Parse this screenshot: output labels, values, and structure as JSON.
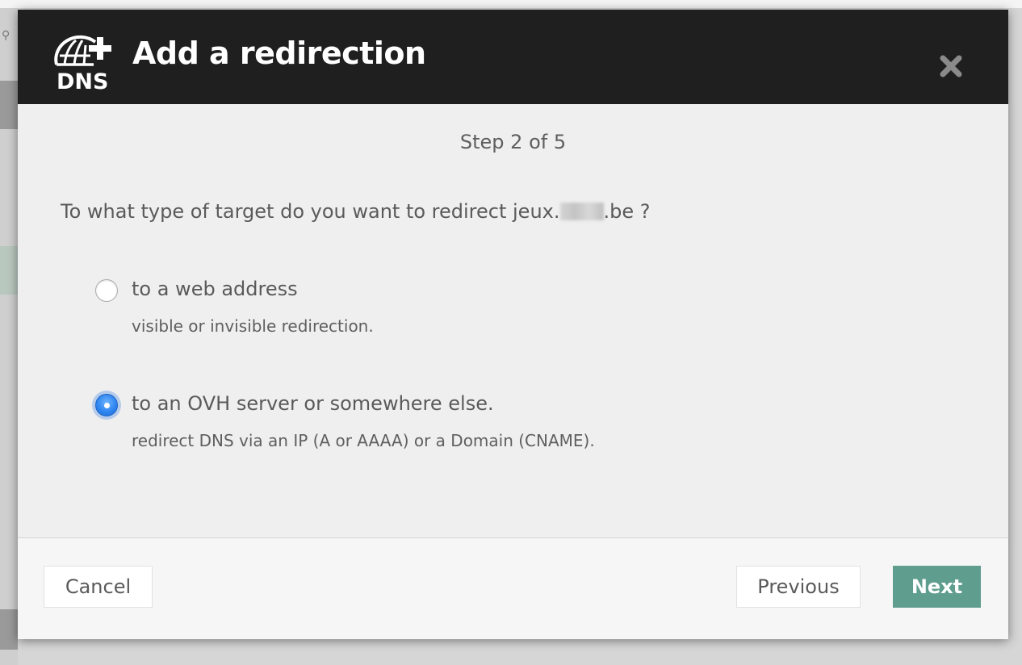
{
  "modal": {
    "title": "Add a redirection",
    "icon": "dns-icon",
    "close_icon": "close-icon",
    "step": "Step 2 of 5",
    "question": {
      "before": "To what type of target do you want to redirect jeux.",
      "after": ".be ?"
    },
    "options": [
      {
        "label": "to a web address",
        "description": "visible or invisible redirection.",
        "selected": false
      },
      {
        "label": "to an OVH server or somewhere else.",
        "description": "redirect DNS via an IP (A or AAAA) or a Domain (CNAME).",
        "selected": true
      }
    ],
    "buttons": {
      "cancel": "Cancel",
      "previous": "Previous",
      "next": "Next"
    }
  },
  "colors": {
    "header_bg": "#1f1f1f",
    "body_bg": "#efefef",
    "next_button": "#5f9e8f",
    "radio_selected": "#2f86f0"
  }
}
